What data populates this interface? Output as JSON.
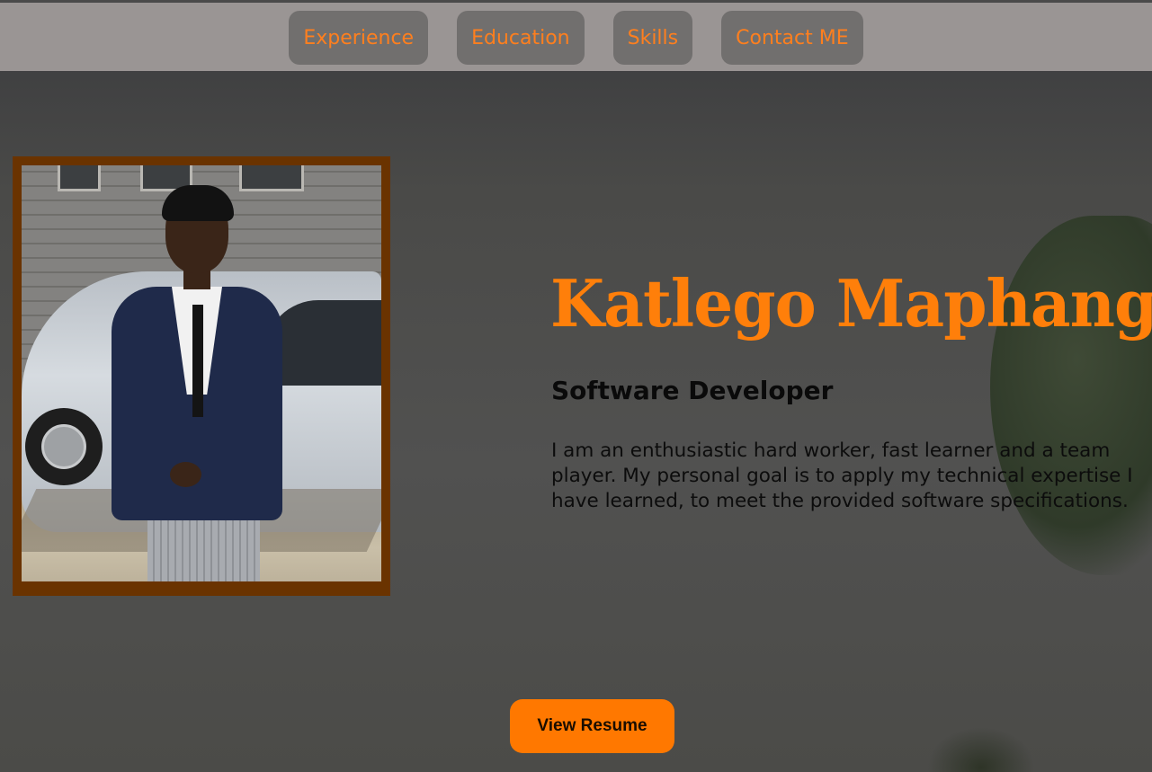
{
  "nav": {
    "items": [
      {
        "label": "Experience"
      },
      {
        "label": "Education"
      },
      {
        "label": "Skills"
      },
      {
        "label": "Contact ME"
      }
    ]
  },
  "hero": {
    "name": "Katlego Maphango",
    "role": "Software Developer",
    "bio": "I am an enthusiastic hard worker, fast learner and a team player. My personal goal is to apply my technical expertise I have learned, to meet the provided software specifications.",
    "resume_label": "View Resume"
  },
  "colors": {
    "accent": "#ff7f0a",
    "nav_bar": "#9a9594",
    "nav_button": "#716f6e",
    "photo_frame": "#6a3300"
  },
  "icons": {
    "profile_photo": "profile-photo"
  }
}
